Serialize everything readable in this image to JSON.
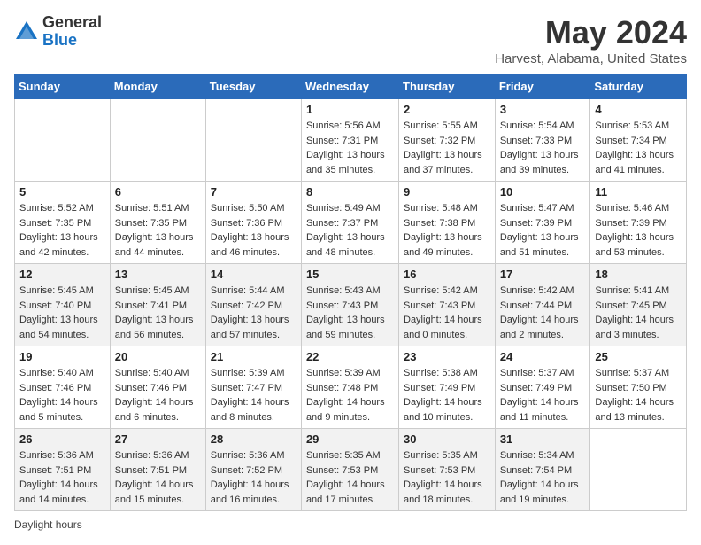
{
  "header": {
    "logo": {
      "line1": "General",
      "line2": "Blue"
    },
    "title": "May 2024",
    "location": "Harvest, Alabama, United States"
  },
  "days_of_week": [
    "Sunday",
    "Monday",
    "Tuesday",
    "Wednesday",
    "Thursday",
    "Friday",
    "Saturday"
  ],
  "weeks": [
    [
      {
        "day": "",
        "info": ""
      },
      {
        "day": "",
        "info": ""
      },
      {
        "day": "",
        "info": ""
      },
      {
        "day": "1",
        "info": "Sunrise: 5:56 AM\nSunset: 7:31 PM\nDaylight: 13 hours\nand 35 minutes."
      },
      {
        "day": "2",
        "info": "Sunrise: 5:55 AM\nSunset: 7:32 PM\nDaylight: 13 hours\nand 37 minutes."
      },
      {
        "day": "3",
        "info": "Sunrise: 5:54 AM\nSunset: 7:33 PM\nDaylight: 13 hours\nand 39 minutes."
      },
      {
        "day": "4",
        "info": "Sunrise: 5:53 AM\nSunset: 7:34 PM\nDaylight: 13 hours\nand 41 minutes."
      }
    ],
    [
      {
        "day": "5",
        "info": "Sunrise: 5:52 AM\nSunset: 7:35 PM\nDaylight: 13 hours\nand 42 minutes."
      },
      {
        "day": "6",
        "info": "Sunrise: 5:51 AM\nSunset: 7:35 PM\nDaylight: 13 hours\nand 44 minutes."
      },
      {
        "day": "7",
        "info": "Sunrise: 5:50 AM\nSunset: 7:36 PM\nDaylight: 13 hours\nand 46 minutes."
      },
      {
        "day": "8",
        "info": "Sunrise: 5:49 AM\nSunset: 7:37 PM\nDaylight: 13 hours\nand 48 minutes."
      },
      {
        "day": "9",
        "info": "Sunrise: 5:48 AM\nSunset: 7:38 PM\nDaylight: 13 hours\nand 49 minutes."
      },
      {
        "day": "10",
        "info": "Sunrise: 5:47 AM\nSunset: 7:39 PM\nDaylight: 13 hours\nand 51 minutes."
      },
      {
        "day": "11",
        "info": "Sunrise: 5:46 AM\nSunset: 7:39 PM\nDaylight: 13 hours\nand 53 minutes."
      }
    ],
    [
      {
        "day": "12",
        "info": "Sunrise: 5:45 AM\nSunset: 7:40 PM\nDaylight: 13 hours\nand 54 minutes."
      },
      {
        "day": "13",
        "info": "Sunrise: 5:45 AM\nSunset: 7:41 PM\nDaylight: 13 hours\nand 56 minutes."
      },
      {
        "day": "14",
        "info": "Sunrise: 5:44 AM\nSunset: 7:42 PM\nDaylight: 13 hours\nand 57 minutes."
      },
      {
        "day": "15",
        "info": "Sunrise: 5:43 AM\nSunset: 7:43 PM\nDaylight: 13 hours\nand 59 minutes."
      },
      {
        "day": "16",
        "info": "Sunrise: 5:42 AM\nSunset: 7:43 PM\nDaylight: 14 hours\nand 0 minutes."
      },
      {
        "day": "17",
        "info": "Sunrise: 5:42 AM\nSunset: 7:44 PM\nDaylight: 14 hours\nand 2 minutes."
      },
      {
        "day": "18",
        "info": "Sunrise: 5:41 AM\nSunset: 7:45 PM\nDaylight: 14 hours\nand 3 minutes."
      }
    ],
    [
      {
        "day": "19",
        "info": "Sunrise: 5:40 AM\nSunset: 7:46 PM\nDaylight: 14 hours\nand 5 minutes."
      },
      {
        "day": "20",
        "info": "Sunrise: 5:40 AM\nSunset: 7:46 PM\nDaylight: 14 hours\nand 6 minutes."
      },
      {
        "day": "21",
        "info": "Sunrise: 5:39 AM\nSunset: 7:47 PM\nDaylight: 14 hours\nand 8 minutes."
      },
      {
        "day": "22",
        "info": "Sunrise: 5:39 AM\nSunset: 7:48 PM\nDaylight: 14 hours\nand 9 minutes."
      },
      {
        "day": "23",
        "info": "Sunrise: 5:38 AM\nSunset: 7:49 PM\nDaylight: 14 hours\nand 10 minutes."
      },
      {
        "day": "24",
        "info": "Sunrise: 5:37 AM\nSunset: 7:49 PM\nDaylight: 14 hours\nand 11 minutes."
      },
      {
        "day": "25",
        "info": "Sunrise: 5:37 AM\nSunset: 7:50 PM\nDaylight: 14 hours\nand 13 minutes."
      }
    ],
    [
      {
        "day": "26",
        "info": "Sunrise: 5:36 AM\nSunset: 7:51 PM\nDaylight: 14 hours\nand 14 minutes."
      },
      {
        "day": "27",
        "info": "Sunrise: 5:36 AM\nSunset: 7:51 PM\nDaylight: 14 hours\nand 15 minutes."
      },
      {
        "day": "28",
        "info": "Sunrise: 5:36 AM\nSunset: 7:52 PM\nDaylight: 14 hours\nand 16 minutes."
      },
      {
        "day": "29",
        "info": "Sunrise: 5:35 AM\nSunset: 7:53 PM\nDaylight: 14 hours\nand 17 minutes."
      },
      {
        "day": "30",
        "info": "Sunrise: 5:35 AM\nSunset: 7:53 PM\nDaylight: 14 hours\nand 18 minutes."
      },
      {
        "day": "31",
        "info": "Sunrise: 5:34 AM\nSunset: 7:54 PM\nDaylight: 14 hours\nand 19 minutes."
      },
      {
        "day": "",
        "info": ""
      }
    ]
  ],
  "footer": {
    "daylight_hours_label": "Daylight hours"
  }
}
